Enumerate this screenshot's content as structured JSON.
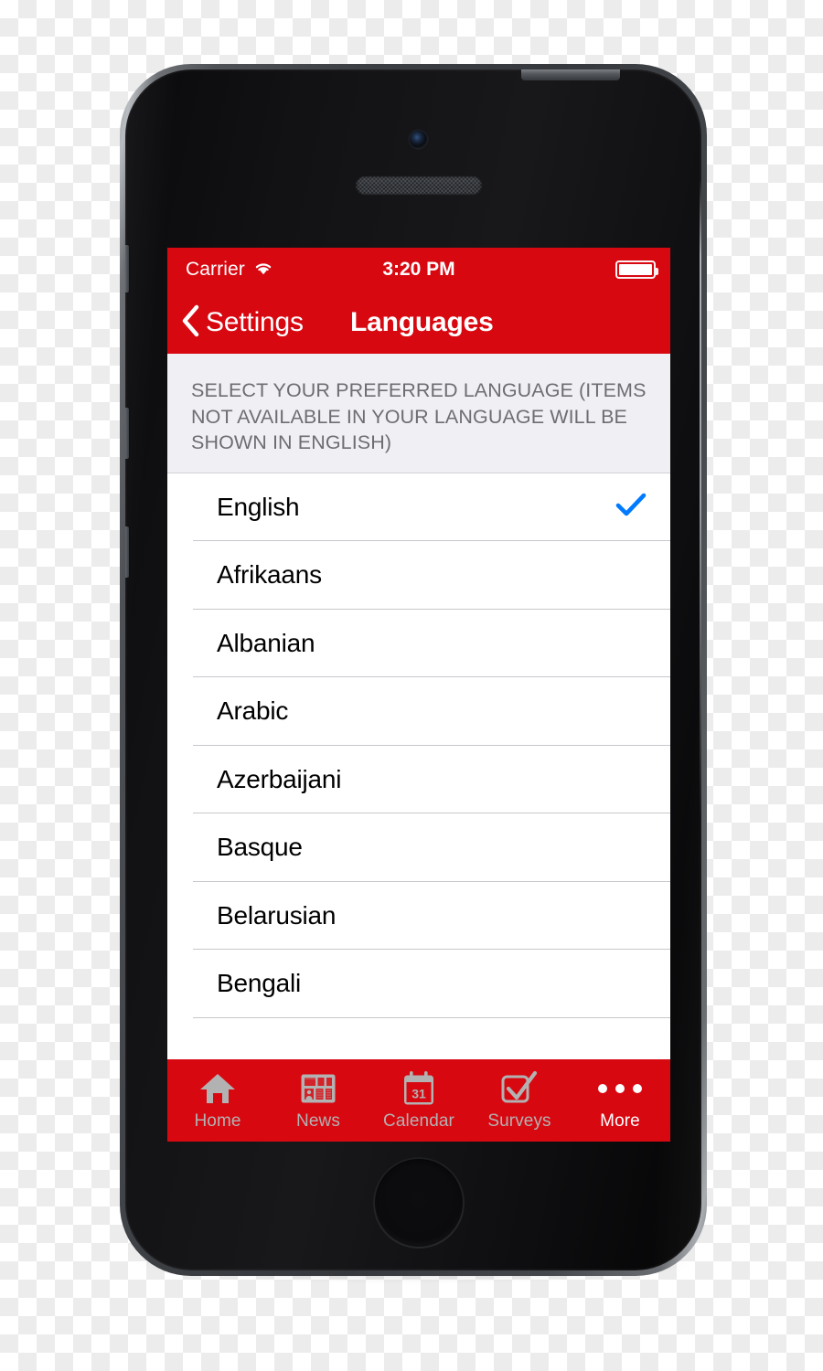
{
  "status_bar": {
    "carrier": "Carrier",
    "wifi_icon": "wifi-icon",
    "time": "3:20 PM",
    "battery_icon": "battery-full-icon"
  },
  "nav_bar": {
    "back_icon": "chevron-left-icon",
    "back_label": "Settings",
    "title": "Languages"
  },
  "section": {
    "header": "SELECT YOUR PREFERRED LANGUAGE (ITEMS NOT AVAILABLE IN YOUR LANGUAGE WILL BE SHOWN IN ENGLISH)"
  },
  "languages": [
    {
      "label": "English",
      "selected": true
    },
    {
      "label": "Afrikaans",
      "selected": false
    },
    {
      "label": "Albanian",
      "selected": false
    },
    {
      "label": "Arabic",
      "selected": false
    },
    {
      "label": "Azerbaijani",
      "selected": false
    },
    {
      "label": "Basque",
      "selected": false
    },
    {
      "label": "Belarusian",
      "selected": false
    },
    {
      "label": "Bengali",
      "selected": false
    }
  ],
  "tab_bar": {
    "items": [
      {
        "label": "Home",
        "icon": "home-icon",
        "active": false
      },
      {
        "label": "News",
        "icon": "news-icon",
        "active": false
      },
      {
        "label": "Calendar",
        "icon": "calendar-icon",
        "active": false,
        "badge_day": "31"
      },
      {
        "label": "Surveys",
        "icon": "survey-icon",
        "active": false
      },
      {
        "label": "More",
        "icon": "ellipsis-icon",
        "active": true
      }
    ]
  },
  "colors": {
    "brand_red": "#D80811",
    "accent_blue": "#007AFF",
    "section_bg": "#EFEFF4",
    "tab_inactive": "#B2B2B2",
    "tab_active": "#FFFFFF"
  },
  "device": {
    "front_camera": "front-camera",
    "earpiece": "earpiece-speaker",
    "home_button": "home-button",
    "power_button": "power-button",
    "mute_switch": "mute-switch",
    "volume_up": "volume-up-button",
    "volume_down": "volume-down-button"
  }
}
